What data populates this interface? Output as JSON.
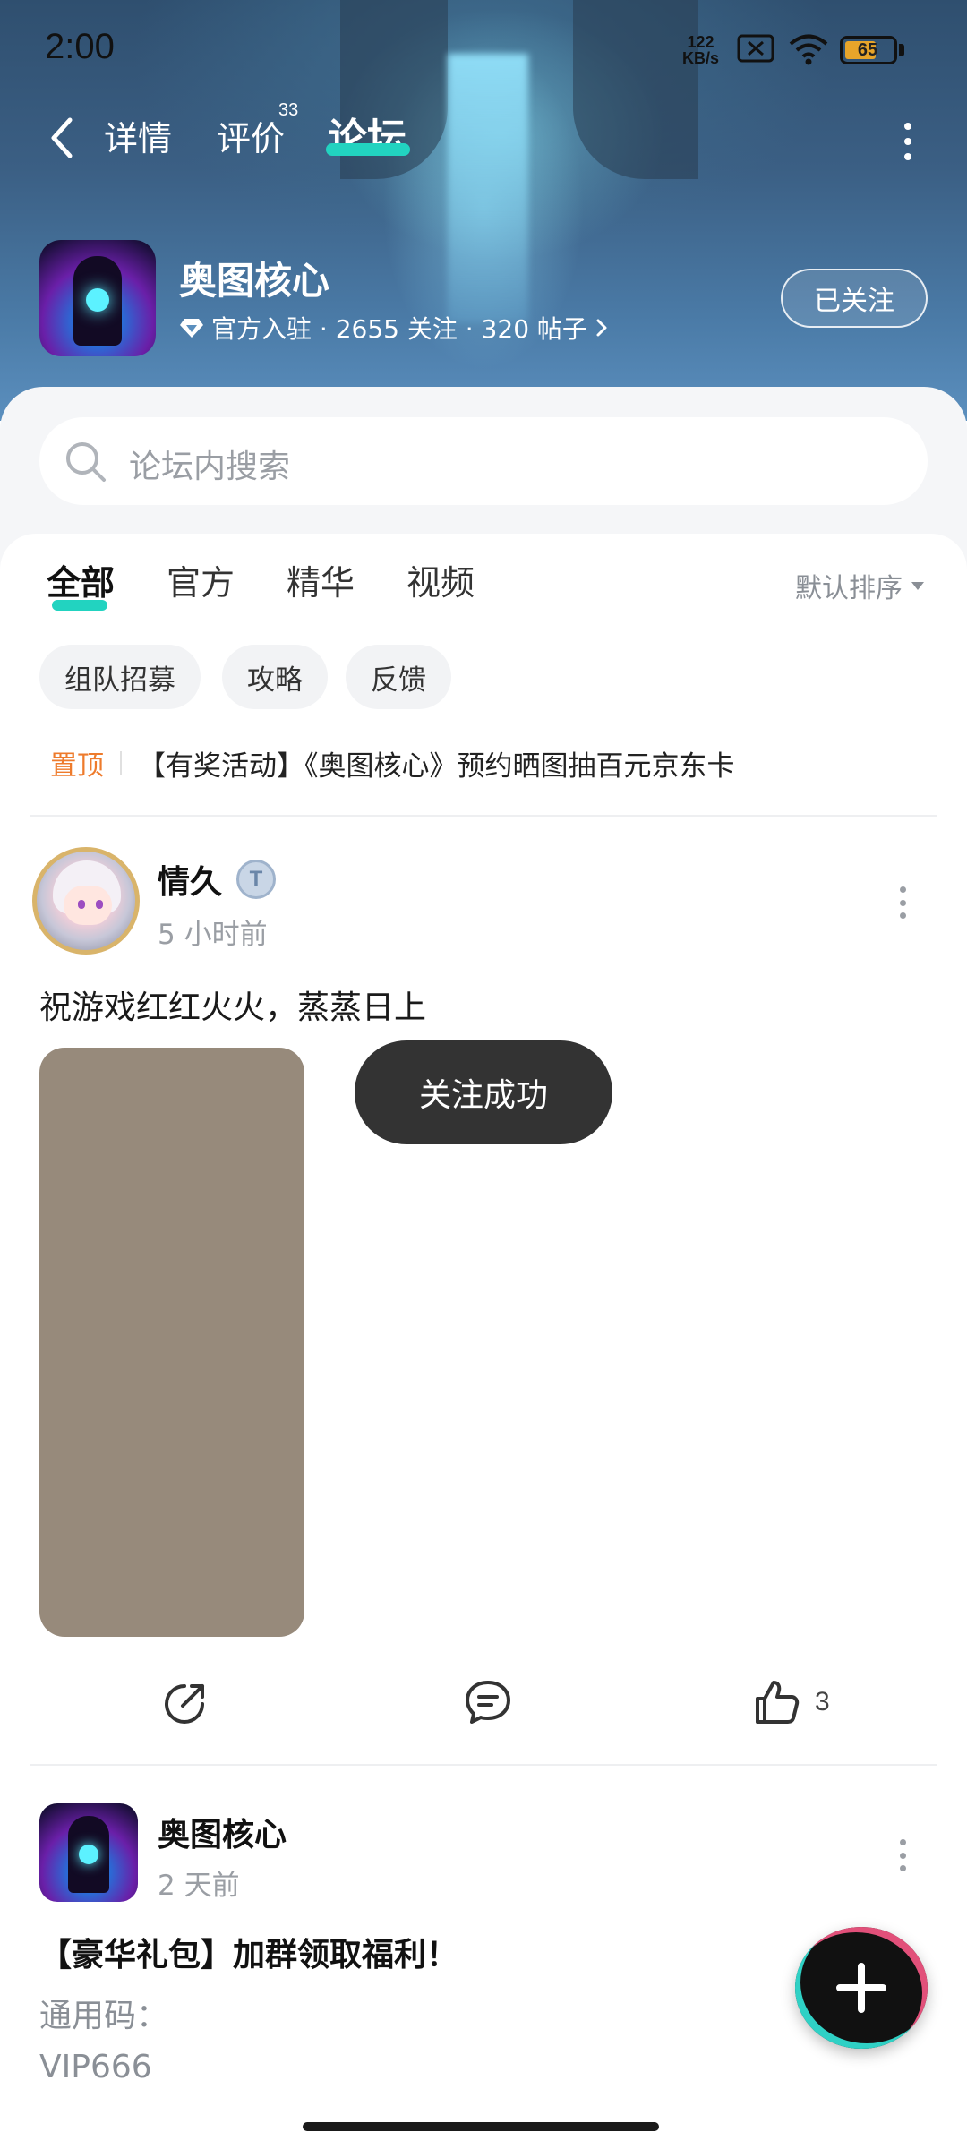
{
  "status_bar": {
    "time": "2:00",
    "network_speed_value": "122",
    "network_speed_unit": "KB/s",
    "battery": "65",
    "battery_level_percent": 65,
    "battery_color": "#e8a52a"
  },
  "nav": {
    "tabs": [
      "详情",
      "评价",
      "论坛"
    ],
    "review_count": "33",
    "active_tab": "论坛",
    "accent_color": "#22d3c0"
  },
  "game": {
    "title": "奥图核心",
    "meta": "官方入驻 · 2655 关注 · 320 帖子",
    "follow_label": "已关注"
  },
  "search": {
    "placeholder": "论坛内搜索"
  },
  "filters": {
    "tabs": [
      "全部",
      "官方",
      "精华",
      "视频"
    ],
    "active": "全部",
    "sort_label": "默认排序",
    "chips": [
      "组队招募",
      "攻略",
      "反馈"
    ]
  },
  "pinned": {
    "badge": "置顶",
    "text": "【有奖活动】《奥图核心》预约晒图抽百元京东卡"
  },
  "posts": [
    {
      "author": "情久",
      "badge": "T",
      "time": "5 小时前",
      "text": "祝游戏红红火火，蒸蒸日上",
      "likes": "3"
    },
    {
      "author": "奥图核心",
      "time": "2 天前",
      "title": "【豪华礼包】加群领取福利！",
      "lines": [
        "通用码：",
        "VIP666"
      ]
    }
  ],
  "toast": {
    "text": "关注成功"
  },
  "icons": {
    "back": "chevron-left-icon",
    "more": "more-vertical-icon",
    "search": "search-icon",
    "share": "share-icon",
    "comment": "comment-icon",
    "like": "thumbs-up-icon",
    "add": "plus-icon",
    "verified": "diamond-icon"
  }
}
